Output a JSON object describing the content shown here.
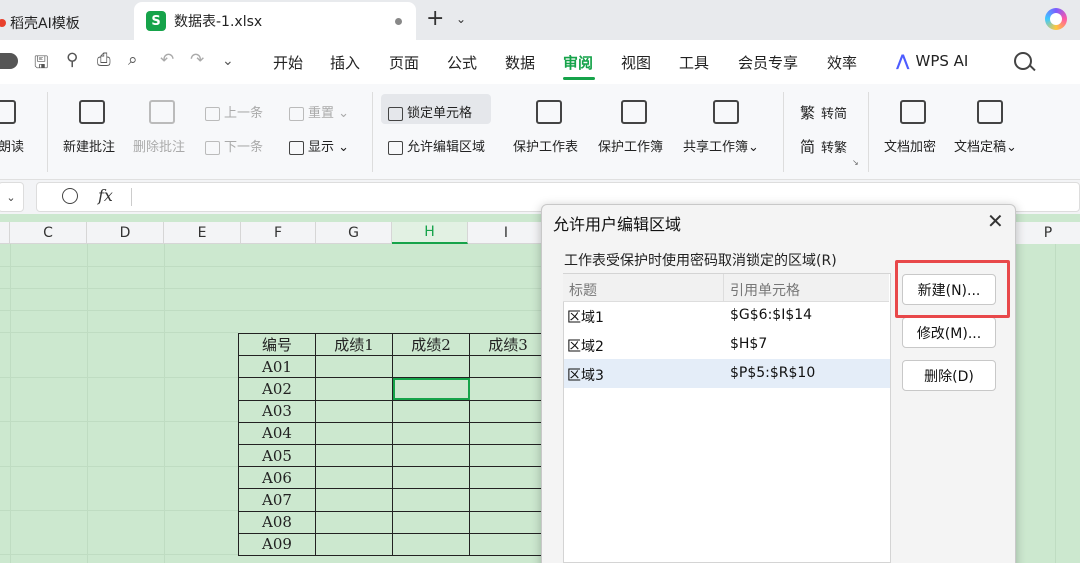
{
  "tabs": {
    "tab1_label": "稻壳AI模板",
    "tab2_icon": "S",
    "tab2_label": "数据表-1.xlsx",
    "new_tab": "+"
  },
  "menu": {
    "items": [
      "开始",
      "插入",
      "页面",
      "公式",
      "数据",
      "审阅",
      "视图",
      "工具",
      "会员专享",
      "效率"
    ],
    "active": "审阅",
    "wps_ai": "WPS AI"
  },
  "ribbon": {
    "read_aloud": "朗读",
    "new_comment": "新建批注",
    "delete_comment": "删除批注",
    "prev": "上一条",
    "next": "下一条",
    "reset": "重置",
    "show": "显示",
    "lock_cells": "锁定单元格",
    "allow_edit": "允许编辑区域",
    "protect_sheet": "保护工作表",
    "protect_book": "保护工作簿",
    "share_book": "共享工作簿",
    "to_simplified": "转简",
    "to_traditional": "转繁",
    "doc_encrypt": "文档加密",
    "doc_final": "文档定稿"
  },
  "formula_bar": {
    "fx": "fx"
  },
  "columns": [
    "C",
    "D",
    "E",
    "F",
    "G",
    "H",
    "I",
    "P"
  ],
  "selected_column": "H",
  "table": {
    "headers": [
      "编号",
      "成绩1",
      "成绩2",
      "成绩3"
    ],
    "ids": [
      "A01",
      "A02",
      "A03",
      "A04",
      "A05",
      "A06",
      "A07",
      "A08",
      "A09"
    ]
  },
  "dialog": {
    "title": "允许用户编辑区域",
    "label": "工作表受保护时使用密码取消锁定的区域(R)",
    "col_title": "标题",
    "col_ref": "引用单元格",
    "rows": [
      {
        "title": "区域1",
        "ref": "$G$6:$I$14"
      },
      {
        "title": "区域2",
        "ref": "$H$7"
      },
      {
        "title": "区域3",
        "ref": "$P$5:$R$10"
      }
    ],
    "selected_row": 2,
    "new_button": "新建(N)...",
    "modify_button": "修改(M)...",
    "delete_button": "删除(D)"
  },
  "colors": {
    "accent": "#16a34a",
    "sheet_fill": "#cce8cf",
    "highlight": "#e8484a"
  }
}
